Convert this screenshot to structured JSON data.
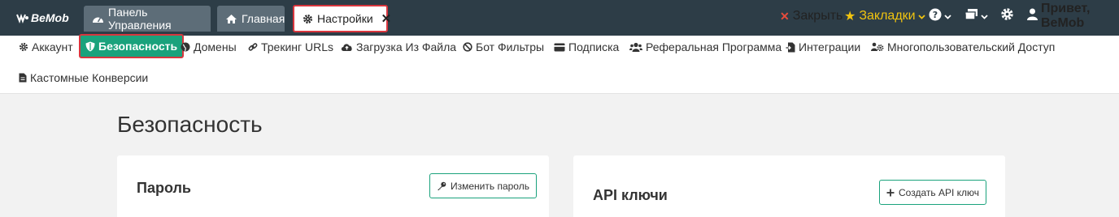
{
  "topbar": {
    "logo": "BeMob",
    "tabs": [
      {
        "label": "Панель Управления",
        "icon": "dashboard-icon"
      },
      {
        "label": "Главная",
        "icon": "home-icon"
      },
      {
        "label": "Настройки",
        "icon": "gear-icon",
        "active": true
      }
    ],
    "close_label": "Закрыть",
    "bookmarks_label": "Закладки",
    "user_greeting": "Привет, BeMob"
  },
  "nav": {
    "items": [
      {
        "label": "Аккаунт",
        "icon": "gear-icon"
      },
      {
        "label": "Безопасность",
        "icon": "shield-icon",
        "active": true
      },
      {
        "label": "Домены",
        "icon": "globe-icon"
      },
      {
        "label": "Трекинг URLs",
        "icon": "link-icon"
      },
      {
        "label": "Загрузка Из Файла",
        "icon": "cloud-upload-icon"
      },
      {
        "label": "Бот Фильтры",
        "icon": "ban-icon"
      },
      {
        "label": "Подписка",
        "icon": "credit-card-icon"
      },
      {
        "label": "Реферальная Программа",
        "icon": "users-icon"
      },
      {
        "label": "Интеграции",
        "icon": "file-import-icon"
      },
      {
        "label": "Многопользовательский Доступ",
        "icon": "users-cog-icon"
      },
      {
        "label": "Кастомные Конверсии",
        "icon": "file-icon"
      }
    ]
  },
  "main": {
    "title": "Безопасность",
    "password_card": {
      "title": "Пароль",
      "button": "Изменить пароль"
    },
    "api_card": {
      "title": "API ключи",
      "button": "Создать API ключ"
    }
  },
  "colors": {
    "topbar": "#2d3d47",
    "accent": "#1aa27c",
    "highlight": "#d9363e",
    "bookmarks": "#f1c40f"
  }
}
